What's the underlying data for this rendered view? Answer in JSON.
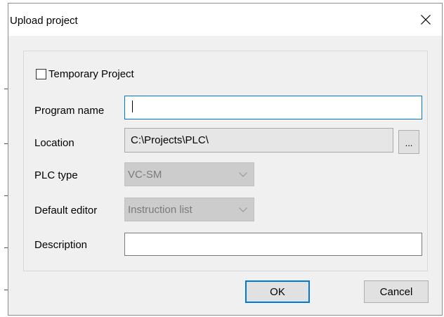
{
  "dialog": {
    "title": "Upload project",
    "close_icon": "close-icon"
  },
  "form": {
    "temporary_project": {
      "label": "Temporary Project",
      "checked": false
    },
    "program_name": {
      "label": "Program name",
      "value": ""
    },
    "location": {
      "label": "Location",
      "value": "C:\\Projects\\PLC\\",
      "browse_label": "..."
    },
    "plc_type": {
      "label": "PLC type",
      "value": "VC-SM"
    },
    "default_editor": {
      "label": "Default editor",
      "value": "Instruction list"
    },
    "description": {
      "label": "Description",
      "value": ""
    }
  },
  "buttons": {
    "ok_label": "OK",
    "cancel_label": "Cancel"
  },
  "colors": {
    "focus_accent": "#0078d7",
    "dialog_background": "#f0f0f0",
    "disabled_field": "#cccccc"
  }
}
